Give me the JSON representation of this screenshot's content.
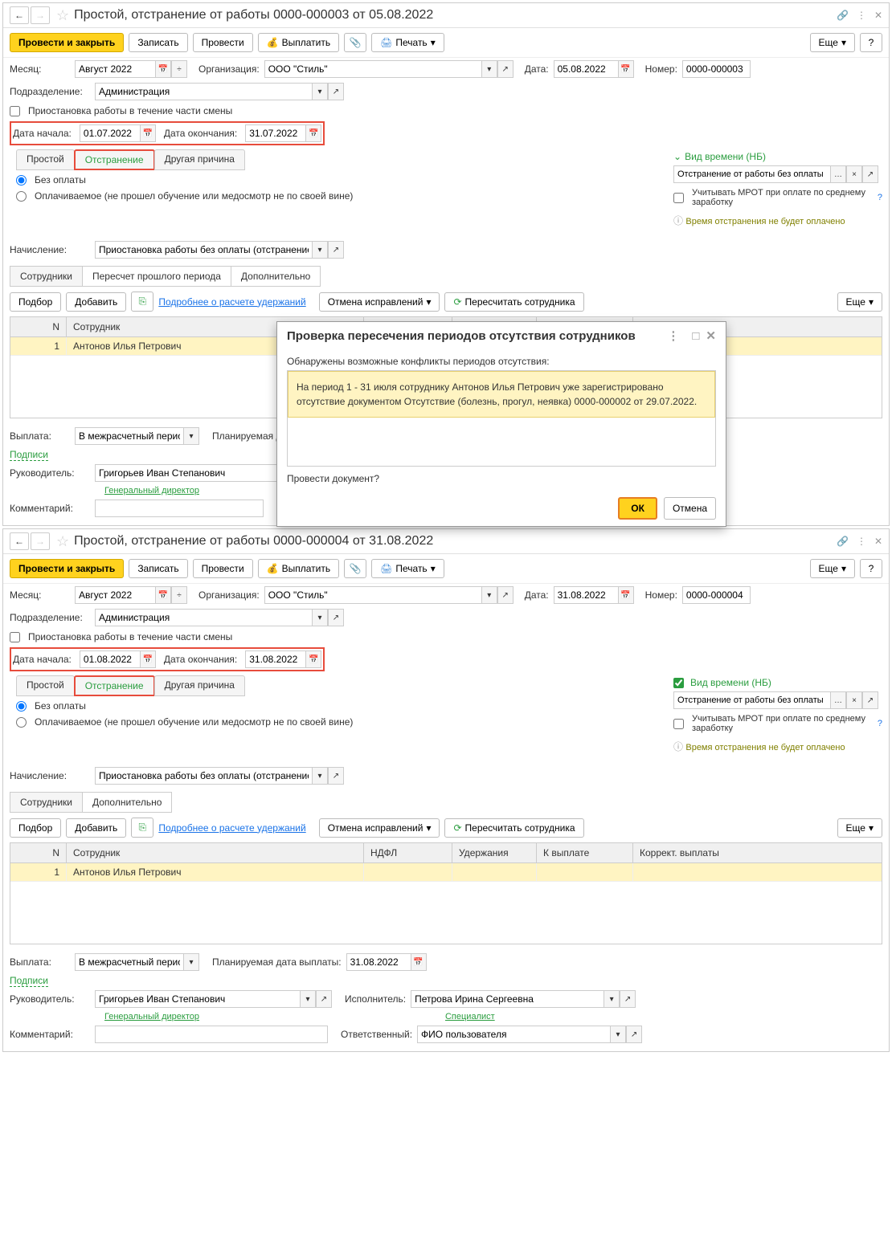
{
  "window1": {
    "title": "Простой, отстранение от работы 0000-000003 от 05.08.2022",
    "toolbar": {
      "submit_close": "Провести и закрыть",
      "save": "Записать",
      "submit": "Провести",
      "pay": "Выплатить",
      "print": "Печать",
      "more": "Еще"
    },
    "fields": {
      "month_label": "Месяц:",
      "month_value": "Август 2022",
      "org_label": "Организация:",
      "org_value": "ООО \"Стиль\"",
      "date_label": "Дата:",
      "date_value": "05.08.2022",
      "number_label": "Номер:",
      "number_value": "0000-000003",
      "dept_label": "Подразделение:",
      "dept_value": "Администрация",
      "pause_shift": "Приостановка работы в течение части смены",
      "start_date_label": "Дата начала:",
      "start_date": "01.07.2022",
      "end_date_label": "Дата окончания:",
      "end_date": "31.07.2022"
    },
    "reason_tabs": {
      "simple": "Простой",
      "removal": "Отстранение",
      "other": "Другая причина"
    },
    "payment": {
      "no_pay": "Без оплаты",
      "paid": "Оплачиваемое (не прошел обучение или медосмотр не по своей вине)"
    },
    "time_type": {
      "header": "Вид времени (НБ)",
      "value": "Отстранение от работы без оплаты",
      "mrot": "Учитывать МРОТ при оплате по среднему заработку",
      "note": "Время отстранения не будет оплачено"
    },
    "accrual_label": "Начисление:",
    "accrual_value": "Приостановка работы без оплаты (отстранение)",
    "section_tabs": {
      "employees": "Сотрудники",
      "recalc": "Пересчет прошлого периода",
      "additional": "Дополнительно"
    },
    "table_toolbar": {
      "select": "Подбор",
      "add": "Добавить",
      "details": "Подробнее о расчете удержаний",
      "cancel_fix": "Отмена исправлений",
      "recalc_emp": "Пересчитать сотрудника",
      "more": "Еще"
    },
    "grid": {
      "headers": {
        "n": "N",
        "emp": "Сотрудник",
        "ndfl": "НДФЛ",
        "ded": "Удержания",
        "pay": "К выплате",
        "corr": "Коррект. выплаты"
      },
      "rows": [
        {
          "n": "1",
          "emp": "Антонов Илья Петрович"
        }
      ]
    },
    "payout_label": "Выплата:",
    "payout_value": "В межрасчетный период",
    "planned_label": "Планируемая дат",
    "signatures": "Подписи",
    "manager_label": "Руководитель:",
    "manager_value": "Григорьев Иван Степанович",
    "manager_title": "Генеральный директор",
    "comment_label": "Комментарий:"
  },
  "dialog": {
    "title": "Проверка пересечения периодов отсутствия сотрудников",
    "subtitle": "Обнаружены возможные конфликты периодов отсутствия:",
    "warning": "На период 1 - 31 июля сотруднику Антонов Илья Петрович уже зарегистрировано отсутствие документом Отсутствие (болезнь, прогул, неявка) 0000-000002 от 29.07.2022.",
    "question": "Провести документ?",
    "ok": "ОК",
    "cancel": "Отмена"
  },
  "window2": {
    "title": "Простой, отстранение от работы 0000-000004 от 31.08.2022",
    "fields": {
      "date_value": "31.08.2022",
      "number_value": "0000-000004",
      "start_date": "01.08.2022",
      "end_date": "31.08.2022"
    },
    "section_tabs": {
      "employees": "Сотрудники",
      "additional": "Дополнительно"
    },
    "planned_label_full": "Планируемая дата выплаты:",
    "planned_value": "31.08.2022",
    "executor_label": "Исполнитель:",
    "executor_value": "Петрова Ирина Сергеевна",
    "executor_title": "Специалист",
    "responsible_label": "Ответственный:",
    "responsible_value": "ФИО пользователя"
  }
}
